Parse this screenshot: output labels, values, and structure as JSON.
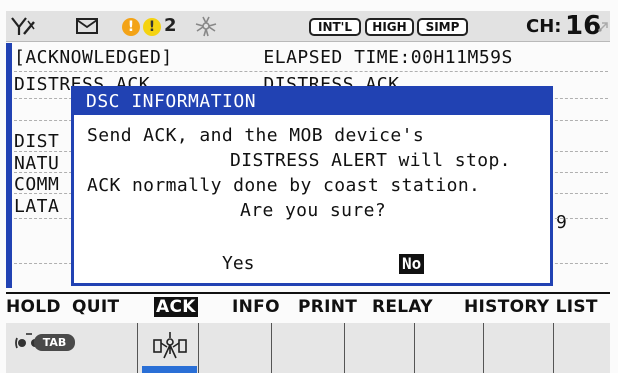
{
  "status": {
    "warning_count": "2",
    "indicators": [
      "INT'L",
      "HIGH",
      "SIMP"
    ],
    "channel_label": "CH:",
    "channel_number": "16",
    "icons": [
      "antenna-off-icon",
      "message-envelope-icon",
      "alert-circle-icon",
      "alert-circle-yellow-icon",
      "settings-cluster-icon",
      "channel-scan-icon"
    ]
  },
  "background": {
    "lines": [
      "[ACKNOWLEDGED]        ELAPSED TIME:00H11M59S",
      "DISTRESS ACK          DISTRESS ACK",
      "DIST",
      "NATU",
      "COMM",
      "LATA"
    ],
    "stray_char": "9"
  },
  "dialog": {
    "title": "DSC INFORMATION",
    "message_lines": [
      "Send ACK, and the MOB device's",
      "DISTRESS ALERT will stop.",
      "ACK normally done by coast station.",
      "Are you sure?"
    ],
    "yes_label": "Yes",
    "no_label": "No",
    "selected": "No"
  },
  "softkeys": [
    {
      "label": "HOLD",
      "highlighted": false
    },
    {
      "label": "QUIT",
      "highlighted": false
    },
    {
      "label": "ACK",
      "highlighted": true
    },
    {
      "label": "INFO",
      "highlighted": false
    },
    {
      "label": "PRINT",
      "highlighted": false
    },
    {
      "label": "RELAY",
      "highlighted": false
    },
    {
      "label": "HISTORY LIST",
      "highlighted": false
    }
  ],
  "tabbar": {
    "tab_label": "TAB",
    "icons": [
      "radio-wave-icon",
      "dsc-distress-icon"
    ]
  },
  "colors": {
    "accent_blue": "#2142b3",
    "tab_active": "#2a6fd6",
    "warning_orange": "#f3a317",
    "warning_yellow": "#f5d311"
  }
}
